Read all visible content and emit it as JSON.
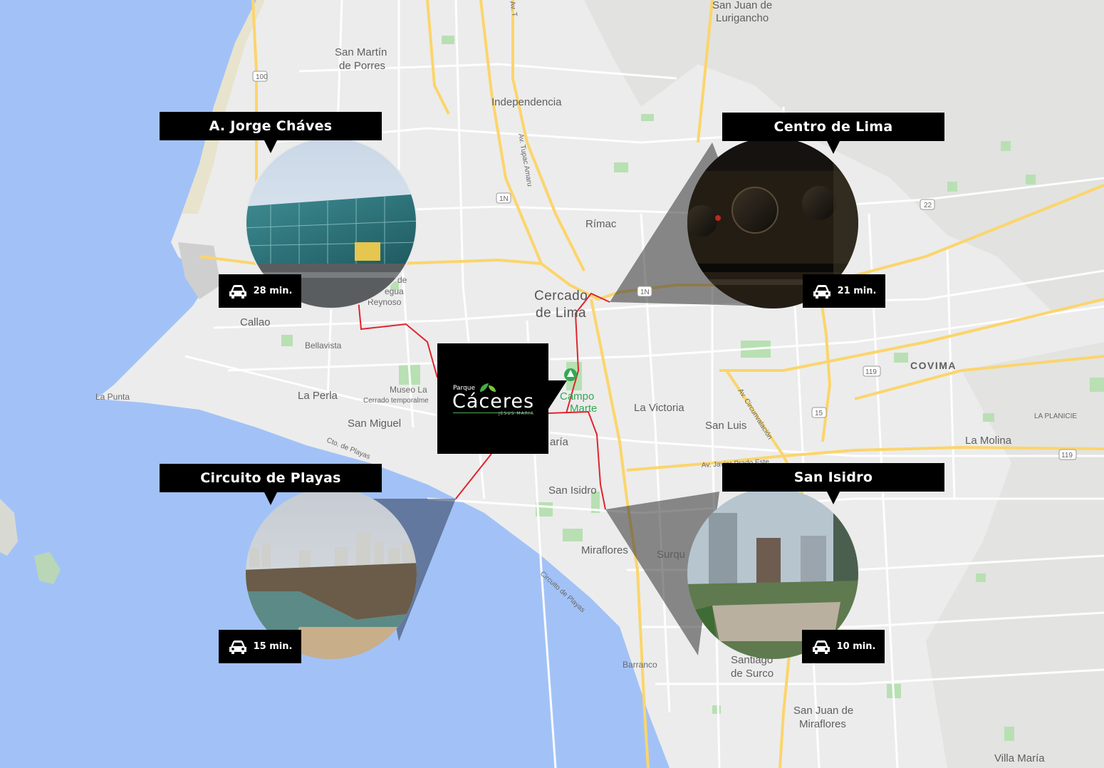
{
  "map": {
    "places": [
      {
        "id": "sjl",
        "lines": [
          "San Juan de",
          "Lurigancho"
        ],
        "style": "normal"
      },
      {
        "id": "smp",
        "lines": [
          "San Martín",
          "de Porres"
        ],
        "style": "normal"
      },
      {
        "id": "independencia",
        "lines": [
          "Independencia"
        ],
        "style": "normal"
      },
      {
        "id": "rimac",
        "lines": [
          "Rímac"
        ],
        "style": "normal"
      },
      {
        "id": "cercado",
        "lines": [
          "Cercado",
          "de Lima"
        ],
        "style": "big"
      },
      {
        "id": "callao",
        "lines": [
          "Callao"
        ],
        "style": "normal"
      },
      {
        "id": "bellavista",
        "lines": [
          "Bellavista"
        ],
        "style": "small"
      },
      {
        "id": "lapunta",
        "lines": [
          "La Punta"
        ],
        "style": "small"
      },
      {
        "id": "laperla",
        "lines": [
          "La Perla"
        ],
        "style": "normal"
      },
      {
        "id": "sanmiguel",
        "lines": [
          "San Miguel"
        ],
        "style": "normal"
      },
      {
        "id": "museo",
        "lines": [
          "Museo La"
        ],
        "style": "small"
      },
      {
        "id": "museo2",
        "lines": [
          "Cerrado temporalme"
        ],
        "style": "tiny"
      },
      {
        "id": "lavictoria",
        "lines": [
          "La Victoria"
        ],
        "style": "normal"
      },
      {
        "id": "sanluis",
        "lines": [
          "San Luis"
        ],
        "style": "normal"
      },
      {
        "id": "covima",
        "lines": [
          "COVIMA"
        ],
        "style": "caps"
      },
      {
        "id": "laplanicie",
        "lines": [
          "LA PLANICIE"
        ],
        "style": "tiny"
      },
      {
        "id": "lamolina",
        "lines": [
          "La Molina"
        ],
        "style": "normal"
      },
      {
        "id": "sanisidro",
        "lines": [
          "San Isidro"
        ],
        "style": "normal"
      },
      {
        "id": "miraflores",
        "lines": [
          "Miraflores"
        ],
        "style": "normal"
      },
      {
        "id": "surquillo",
        "lines": [
          "Surqu"
        ],
        "style": "normal"
      },
      {
        "id": "barranco",
        "lines": [
          "Barranco"
        ],
        "style": "small"
      },
      {
        "id": "surco",
        "lines": [
          "Santiago",
          "de Surco"
        ],
        "style": "normal"
      },
      {
        "id": "sjm",
        "lines": [
          "San Juan de",
          "Miraflores"
        ],
        "style": "normal"
      },
      {
        "id": "villamaria",
        "lines": [
          "Villa María"
        ],
        "style": "normal"
      },
      {
        "id": "campomarte",
        "lines": [
          "Campo",
          "Marte"
        ],
        "style": "green"
      },
      {
        "id": "maria",
        "lines": [
          "aría"
        ],
        "style": "normal"
      },
      {
        "id": "reynoso",
        "lines": [
          "de",
          "egua",
          "Reynoso"
        ],
        "style": "small"
      }
    ],
    "roads": [
      {
        "id": "r100",
        "text": "100"
      },
      {
        "id": "r1n",
        "text": "1N"
      },
      {
        "id": "r1n2",
        "text": "1N"
      },
      {
        "id": "r22",
        "text": "22"
      },
      {
        "id": "r119",
        "text": "119"
      },
      {
        "id": "r119b",
        "text": "119"
      },
      {
        "id": "r15",
        "text": "15"
      },
      {
        "id": "tupac",
        "text": "Av. Tupac Amaru"
      },
      {
        "id": "circunvalacion",
        "text": "Av. Circunvalación"
      },
      {
        "id": "javierprado",
        "text": "Av. Javier Prado Este"
      },
      {
        "id": "ctoplayas",
        "text": "Cto. de Playas"
      },
      {
        "id": "circuitoplayas",
        "text": "Circuito de Playas"
      },
      {
        "id": "avtop",
        "text": "Av. T"
      }
    ]
  },
  "logo": {
    "small": "Parque",
    "main": "Cáceres",
    "sub": "JESUS MARIA"
  },
  "destinations": [
    {
      "title": "A. Jorge Cháves",
      "time": "28 min."
    },
    {
      "title": "Centro de Lima",
      "time": "21 min."
    },
    {
      "title": "Circuito de Playas",
      "time": "15 min."
    },
    {
      "title": "San Isidro",
      "time": "10 min."
    }
  ],
  "colors": {
    "sea": "#a2c2f7",
    "land": "#ececec",
    "route": "#e0242e",
    "highway": "#fcd86a",
    "park": "#b7e0b0"
  }
}
